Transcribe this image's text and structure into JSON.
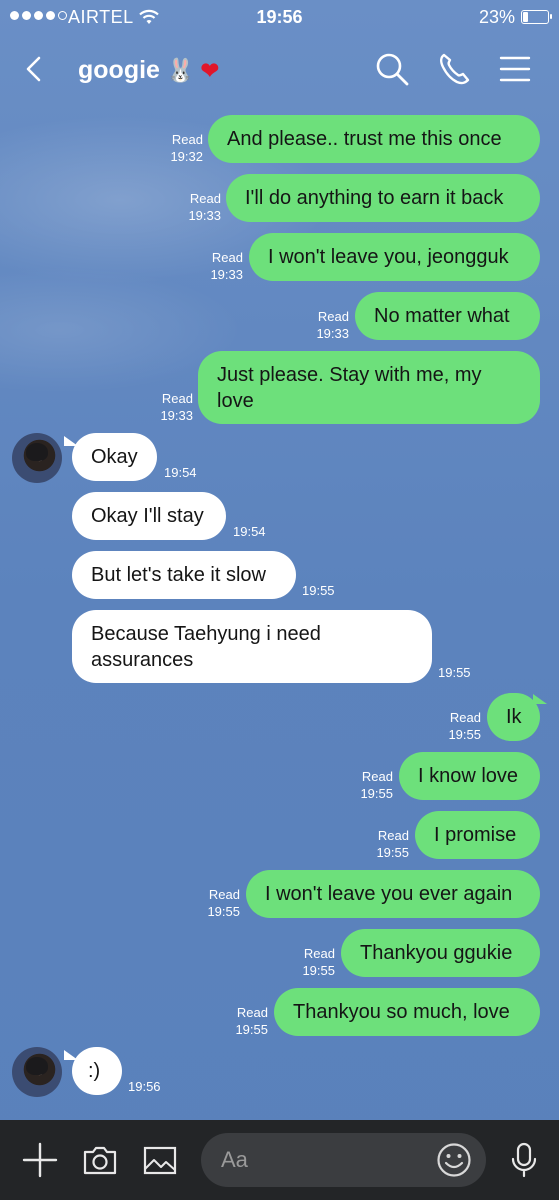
{
  "status_bar": {
    "carrier": "AIRTEL",
    "time": "19:56",
    "battery": "23%",
    "battery_level": 0.23
  },
  "header": {
    "title": "googie",
    "title_emoji_1": "🐰",
    "title_emoji_2": "❤"
  },
  "messages": [
    {
      "side": "out",
      "text": "And please.. trust me this once",
      "read": "Read",
      "time": "19:32"
    },
    {
      "side": "out",
      "text": "I'll do anything to earn it back",
      "read": "Read",
      "time": "19:33"
    },
    {
      "side": "out",
      "text": "I won't leave you, jeongguk",
      "read": "Read",
      "time": "19:33"
    },
    {
      "side": "out",
      "text": "No matter what",
      "read": "Read",
      "time": "19:33"
    },
    {
      "side": "out",
      "text": "Just please. Stay with me, my love",
      "read": "Read",
      "time": "19:33"
    },
    {
      "side": "in",
      "text": "Okay",
      "time": "19:54"
    },
    {
      "side": "in",
      "text": "Okay I'll stay",
      "time": "19:54"
    },
    {
      "side": "in",
      "text": "But let's take it slow",
      "time": "19:55"
    },
    {
      "side": "in",
      "text": "Because Taehyung i need assurances",
      "time": "19:55"
    },
    {
      "side": "out",
      "text": "Ik",
      "read": "Read",
      "time": "19:55"
    },
    {
      "side": "out",
      "text": "I know love",
      "read": "Read",
      "time": "19:55"
    },
    {
      "side": "out",
      "text": "I promise",
      "read": "Read",
      "time": "19:55"
    },
    {
      "side": "out",
      "text": "I won't leave you ever again",
      "read": "Read",
      "time": "19:55"
    },
    {
      "side": "out",
      "text": "Thankyou ggukie",
      "read": "Read",
      "time": "19:55"
    },
    {
      "side": "out",
      "text": "Thankyou so much, love",
      "read": "Read",
      "time": "19:55"
    },
    {
      "side": "in",
      "text": ":)",
      "time": "19:56"
    }
  ],
  "composer": {
    "placeholder": "Aa"
  },
  "colors": {
    "outgoing_bubble": "#6de07b",
    "incoming_bubble": "#ffffff",
    "background": "#5f86bd",
    "bottom_bar": "#232527"
  },
  "icons": [
    "back-chevron-icon",
    "search-icon",
    "phone-icon",
    "menu-icon",
    "plus-icon",
    "camera-icon",
    "image-icon",
    "emoji-icon",
    "microphone-icon"
  ]
}
